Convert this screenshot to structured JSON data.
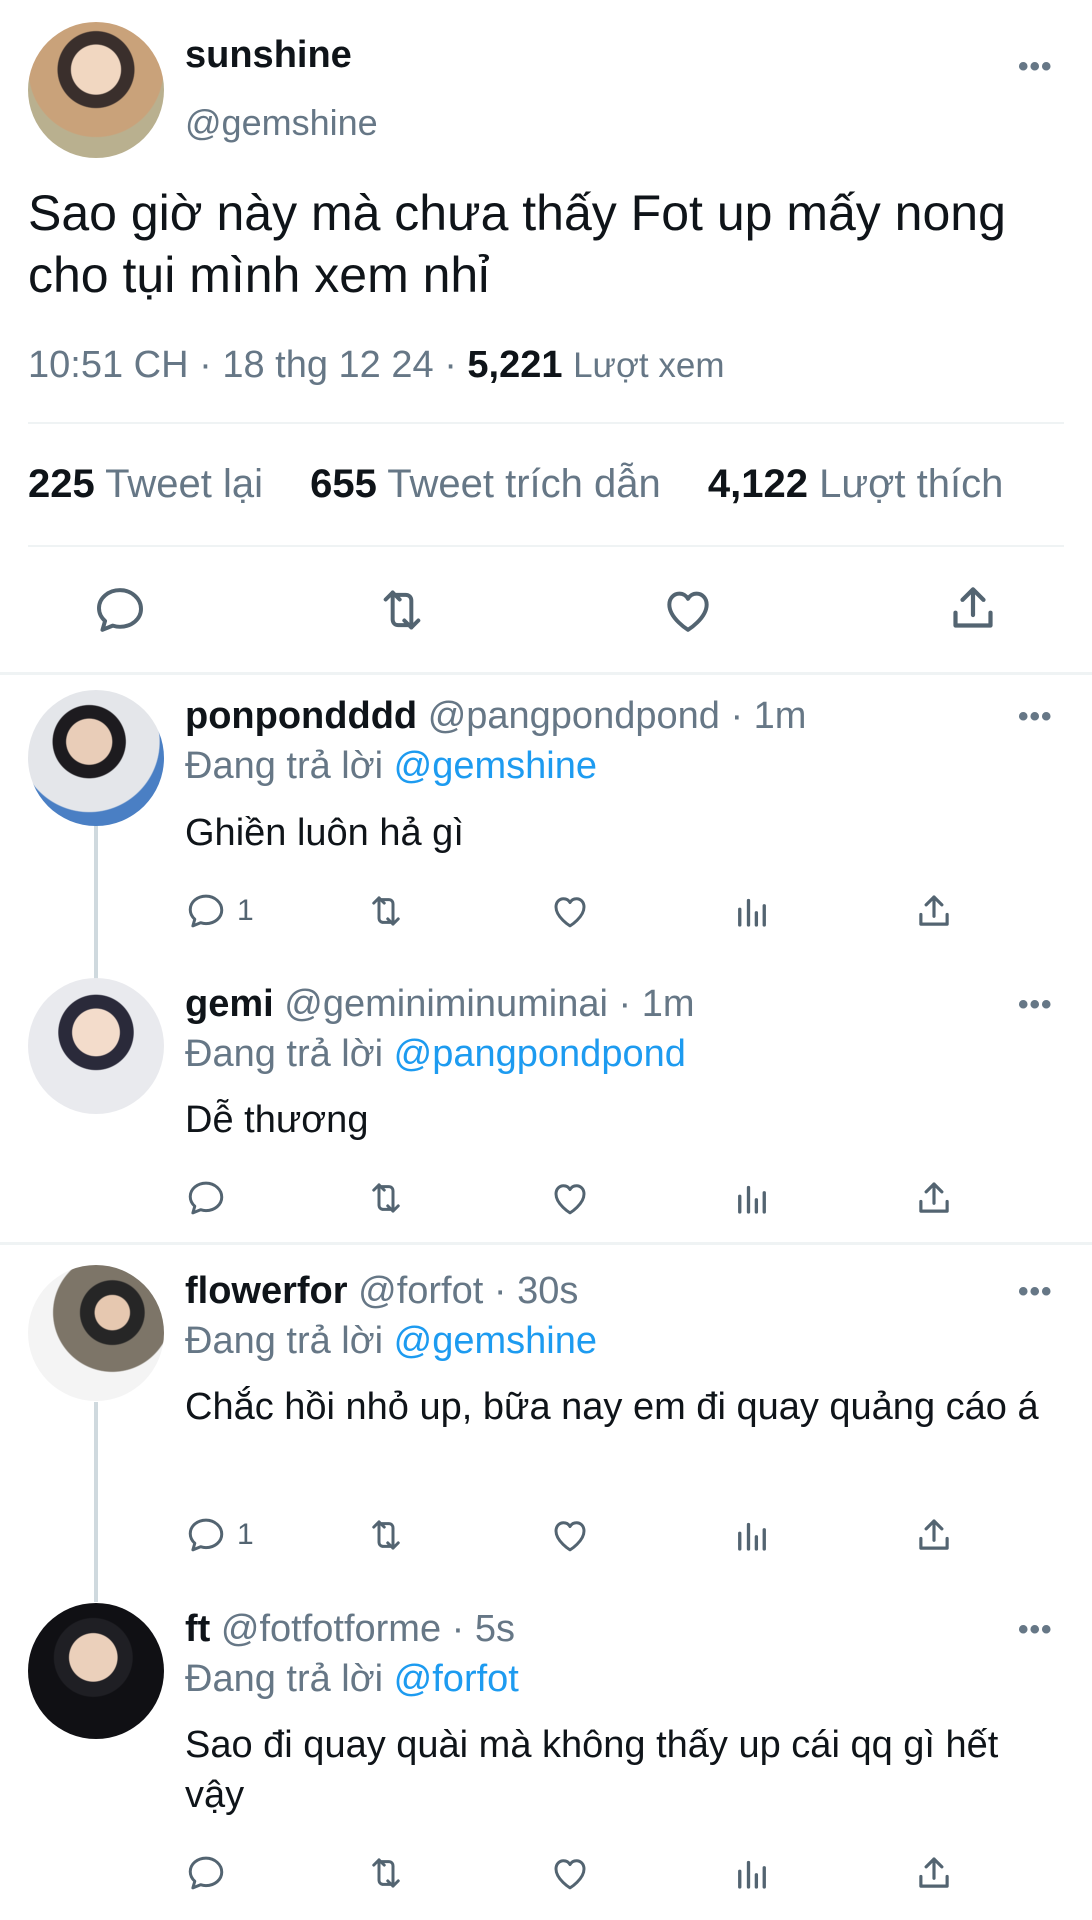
{
  "tweet": {
    "author_name": "sunshine",
    "author_handle": "@gemshine",
    "text": "Sao giờ này mà chưa thấy Fot up mấy nong cho tụi mình xem nhỉ",
    "time": "10:51 CH",
    "date": "18 thg 12 24",
    "views_count": "5,221",
    "views_label": "Lượt xem",
    "retweets_count": "225",
    "retweets_label": "Tweet lại",
    "quotes_count": "655",
    "quotes_label": "Tweet trích dẫn",
    "likes_count": "4,122",
    "likes_label": "Lượt thích",
    "more": "•••"
  },
  "replies": [
    {
      "name": "ponpondddd",
      "handle": "@pangpondpond",
      "time": "1m",
      "replying_label": "Đang trả lời",
      "replying_to": "@gemshine",
      "text": "Ghiền luôn hả gì",
      "reply_count": "1"
    },
    {
      "name": "gemi",
      "handle": "@geminiminuminai",
      "time": "1m",
      "replying_label": "Đang trả lời",
      "replying_to": "@pangpondpond",
      "text": "Dễ thương",
      "reply_count": ""
    },
    {
      "name": "flowerfor",
      "handle": "@forfot",
      "time": "30s",
      "replying_label": "Đang trả lời",
      "replying_to": "@gemshine",
      "text": "Chắc hồi nhỏ up, bữa nay em đi quay quảng cáo á",
      "reply_count": "1"
    },
    {
      "name": "ft",
      "handle": "@fotfotforme",
      "time": "5s",
      "replying_label": "Đang trả lời",
      "replying_to": "@forfot",
      "text": "Sao đi quay quài mà không thấy up cái qq gì hết vậy",
      "reply_count": ""
    }
  ],
  "icons": {
    "reply": "reply-icon",
    "retweet": "retweet-icon",
    "like": "heart-icon",
    "views": "views-icon",
    "share": "share-icon",
    "more": "more-icon"
  },
  "colors": {
    "link": "#1d9bf0",
    "secondary_text": "#667786",
    "primary_text": "#0f1419",
    "divider": "#eff3f4",
    "thread_line": "#cfd9de"
  }
}
